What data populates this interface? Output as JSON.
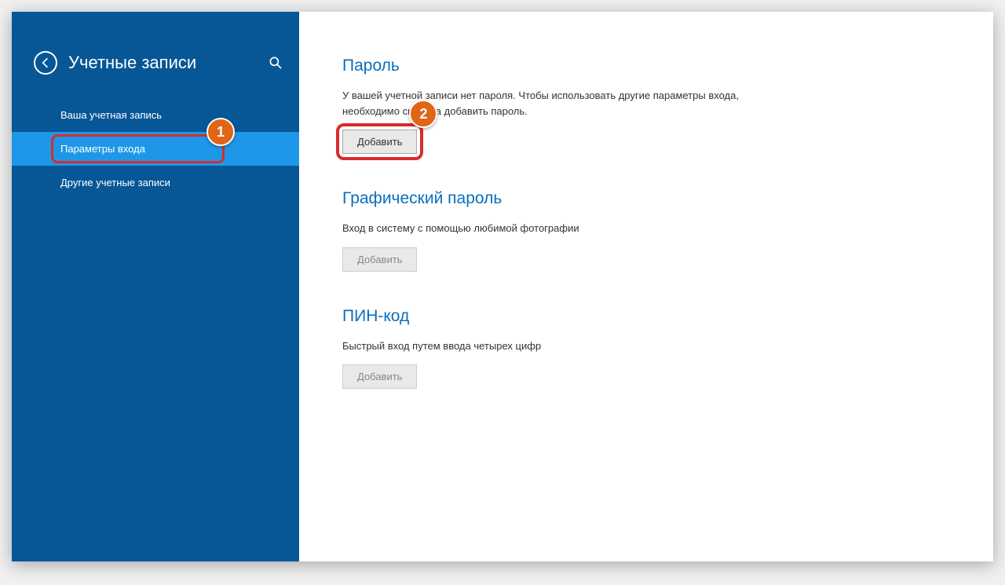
{
  "sidebar": {
    "title": "Учетные записи",
    "items": [
      {
        "label": "Ваша учетная запись"
      },
      {
        "label": "Параметры входа"
      },
      {
        "label": "Другие учетные записи"
      }
    ]
  },
  "sections": {
    "password": {
      "title": "Пароль",
      "desc": "У вашей учетной записи нет пароля. Чтобы использовать другие параметры входа, необходимо сначала добавить пароль.",
      "button": "Добавить"
    },
    "picture": {
      "title": "Графический пароль",
      "desc": "Вход в систему с помощью любимой фотографии",
      "button": "Добавить"
    },
    "pin": {
      "title": "ПИН-код",
      "desc": "Быстрый вход путем ввода четырех цифр",
      "button": "Добавить"
    }
  },
  "annotations": {
    "step1": "1",
    "step2": "2"
  }
}
